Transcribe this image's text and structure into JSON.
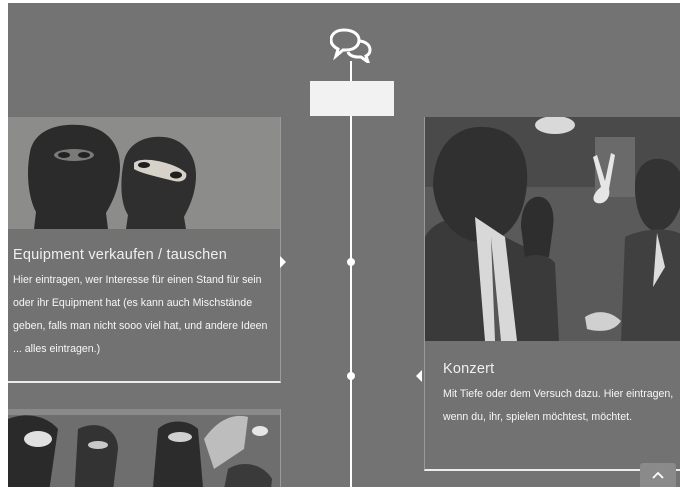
{
  "timeline": {
    "items": [
      {
        "title": "Equipment verkaufen / tauschen",
        "body": "Hier eintragen, wer Interesse für einen Stand für sein oder ihr Equipment hat (es kann auch Mischstände geben, falls man nicht sooo viel hat, und andere Ideen ... alles eintragen.)"
      },
      {
        "title": "Konzert",
        "body": "Mit Tiefe oder dem Versuch dazu. Hier eintragen, wenn du, ihr, spielen möchtest, möchtet."
      }
    ]
  },
  "icons": {
    "header": "chat-bubbles-icon",
    "scroll_top": "chevron-up-icon"
  },
  "colors": {
    "background": "#737373",
    "line": "#ffffff",
    "text": "#f0f0f0"
  }
}
